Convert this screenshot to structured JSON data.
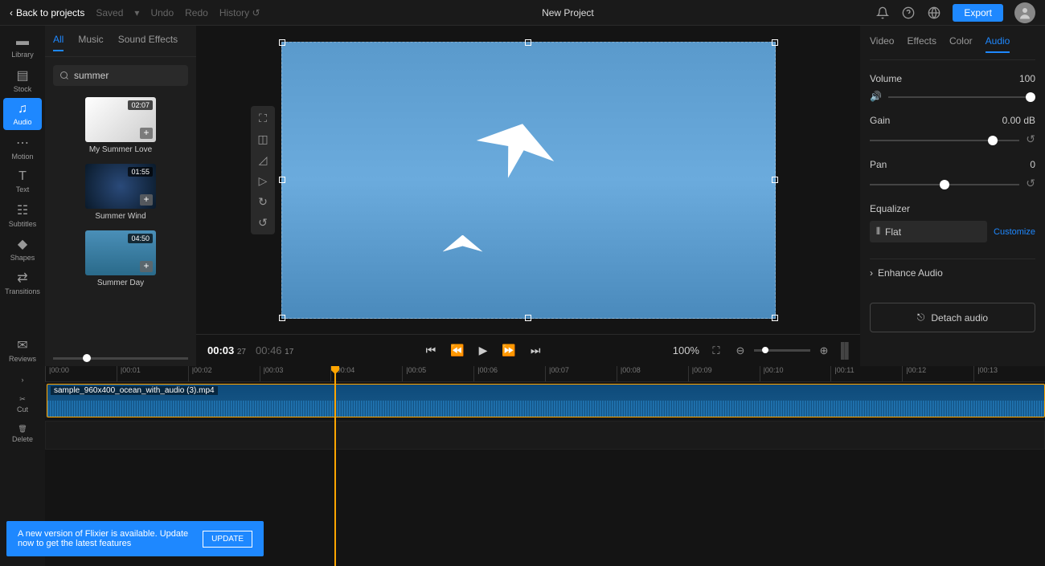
{
  "topbar": {
    "back": "Back to projects",
    "saved": "Saved",
    "undo": "Undo",
    "redo": "Redo",
    "history": "History",
    "title": "New Project",
    "export": "Export"
  },
  "leftrail": [
    {
      "label": "Library",
      "icon": "folder"
    },
    {
      "label": "Stock",
      "icon": "stock"
    },
    {
      "label": "Audio",
      "icon": "audio",
      "active": true
    },
    {
      "label": "Motion",
      "icon": "motion"
    },
    {
      "label": "Text",
      "icon": "text"
    },
    {
      "label": "Subtitles",
      "icon": "subtitles"
    },
    {
      "label": "Shapes",
      "icon": "shapes"
    },
    {
      "label": "Transitions",
      "icon": "transitions"
    },
    {
      "label": "Reviews",
      "icon": "reviews"
    }
  ],
  "library": {
    "tabs": [
      "All",
      "Music",
      "Sound Effects"
    ],
    "active_tab": "All",
    "search": "summer",
    "items": [
      {
        "title": "My Summer Love",
        "duration": "02:07"
      },
      {
        "title": "Summer Wind",
        "duration": "01:55"
      },
      {
        "title": "Summer Day",
        "duration": "04:50"
      }
    ]
  },
  "preview": {
    "current_time": "00:03",
    "current_frame": "27",
    "total_time": "00:46",
    "total_frame": "17",
    "zoom": "100%"
  },
  "right_panel": {
    "tabs": [
      "Video",
      "Effects",
      "Color",
      "Audio"
    ],
    "active_tab": "Audio",
    "volume": {
      "label": "Volume",
      "value": "100"
    },
    "gain": {
      "label": "Gain",
      "value": "0.00 dB"
    },
    "pan": {
      "label": "Pan",
      "value": "0"
    },
    "equalizer": {
      "label": "Equalizer",
      "preset": "Flat",
      "customize": "Customize"
    },
    "enhance": "Enhance Audio",
    "detach": "Detach audio"
  },
  "timeline": {
    "actions": [
      {
        "label": "",
        "icon": "expand"
      },
      {
        "label": "Cut",
        "icon": "cut"
      },
      {
        "label": "Delete",
        "icon": "delete"
      }
    ],
    "ruler": [
      "00:00",
      "00:01",
      "00:02",
      "00:03",
      "00:04",
      "00:05",
      "00:06",
      "00:07",
      "00:08",
      "00:09",
      "00:10",
      "00:11",
      "00:12",
      "00:13"
    ],
    "clip_name": "sample_960x400_ocean_with_audio (3).mp4"
  },
  "banner": {
    "text": "A new version of Flixier is available. Update now to get the latest features",
    "button": "UPDATE"
  }
}
